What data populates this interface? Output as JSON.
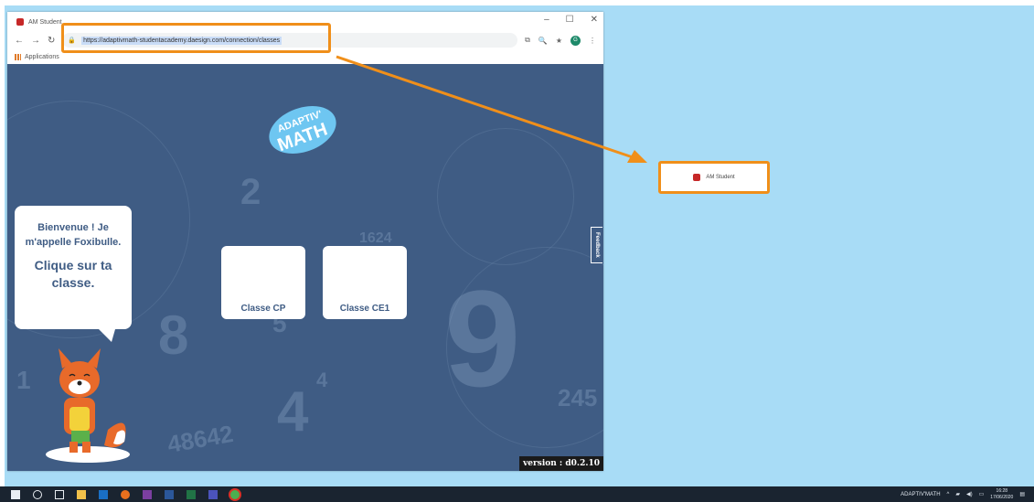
{
  "browser": {
    "tab_title": "AM Student",
    "url": "https://adaptivmath-studentacademy.daesign.com/connection/classes",
    "bookmarks_label": "Applications",
    "avatar_letter": "G"
  },
  "app": {
    "logo_line1": "ADAPTIV'",
    "logo_line2": "MATH",
    "speech_line1": "Bienvenue ! Je m'appelle Foxibulle.",
    "speech_line2": "Clique sur ta classe.",
    "classes": [
      "Classe CP",
      "Classe CE1"
    ],
    "feedback_label": "Feedback",
    "version": "version : d0.2.10",
    "background_numbers": [
      "2",
      "8",
      "5",
      "4",
      "4",
      "9",
      "1",
      "245",
      "48642",
      "1624"
    ]
  },
  "callout": {
    "label": "AM Student"
  },
  "taskbar": {
    "app_label": "ADAPTIV'MATH",
    "time": "16:28",
    "date": "17/06/2020"
  },
  "colors": {
    "annotation": "#f08f1a",
    "app_bg": "#3f5c84",
    "desktop": "#a8dcf6"
  }
}
